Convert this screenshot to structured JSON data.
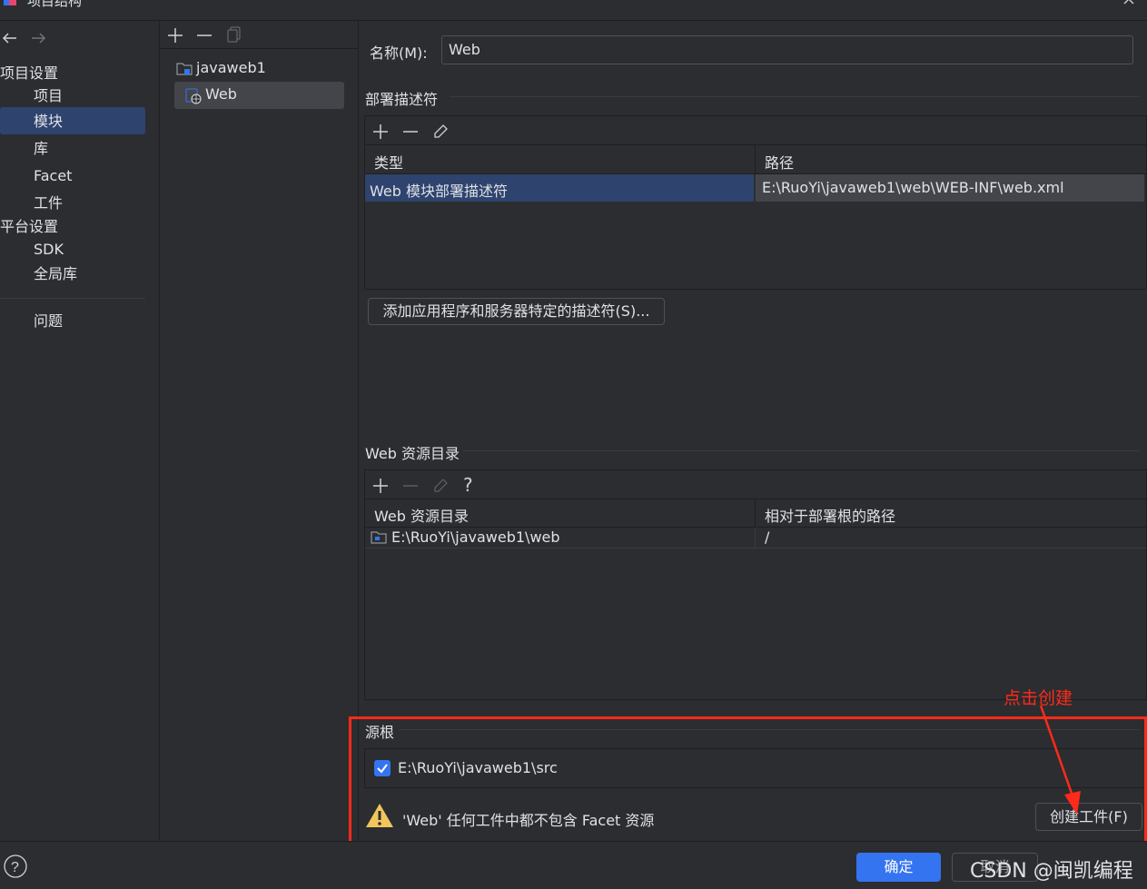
{
  "window": {
    "title": "项目结构"
  },
  "nav": {
    "back_icon": "arrow-left-icon",
    "forward_icon": "arrow-right-icon",
    "project_settings_header": "项目设置",
    "items_project": [
      "项目",
      "模块",
      "库",
      "Facet",
      "工件"
    ],
    "platform_settings_header": "平台设置",
    "items_platform": [
      "SDK",
      "全局库"
    ],
    "problems": "问题",
    "selected": "模块"
  },
  "tree": {
    "toolbar_icons": [
      "plus-icon",
      "minus-icon",
      "copy-icon"
    ],
    "root": "javaweb1",
    "child": "Web"
  },
  "main": {
    "name_label": "名称(M):",
    "name_value": "Web",
    "deploy_section": "部署描述符",
    "deploy_toolbar": [
      "plus-icon",
      "minus-icon",
      "edit-icon"
    ],
    "deploy_columns": [
      "类型",
      "路径"
    ],
    "deploy_rows": [
      [
        "Web 模块部署描述符",
        "E:\\RuoYi\\javaweb1\\web\\WEB-INF\\web.xml"
      ]
    ],
    "add_descriptor_button": "添加应用程序和服务器特定的描述符(S)...",
    "resources_section": "Web 资源目录",
    "resources_toolbar": [
      "plus-icon",
      "minus-icon",
      "edit-icon",
      "help-icon"
    ],
    "resources_columns": [
      "Web 资源目录",
      "相对于部署根的路径"
    ],
    "resources_rows": [
      [
        "E:\\RuoYi\\javaweb1\\web",
        "/"
      ]
    ],
    "source_roots_section": "源根",
    "source_root": "E:\\RuoYi\\javaweb1\\src",
    "source_root_checked": true,
    "warning_text": "'Web' 任何工件中都不包含 Facet 资源",
    "create_artifact_button": "创建工件(F)"
  },
  "annotation": {
    "text": "点击创建",
    "color": "#ff2a1a"
  },
  "footer": {
    "help_icon": "help-icon",
    "ok_button": "确定",
    "cancel_button": "取消",
    "watermark": "CSDN @闽凯编程"
  },
  "colors": {
    "background": "#2b2d30",
    "selection": "#2e436e",
    "primary_button": "#3574f0",
    "highlight_box": "#ff2a1a",
    "warning": "#f2c55c"
  }
}
